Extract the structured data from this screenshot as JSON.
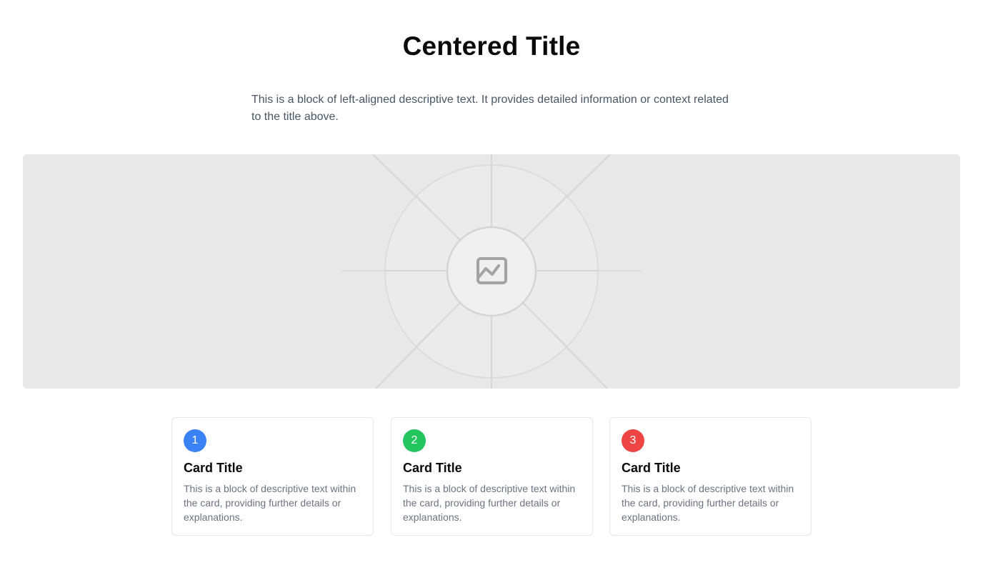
{
  "header": {
    "title": "Centered Title",
    "description": "This is a block of left-aligned descriptive text. It provides detailed information or context related to the title above."
  },
  "hero": {
    "icon": "image-placeholder-icon",
    "background_color": "#e8e8e8"
  },
  "cards": [
    {
      "number": "1",
      "title": "Card Title",
      "text": "This is a block of descriptive text within the card, providing further details or explanations.",
      "badge_color": "#3b82f6"
    },
    {
      "number": "2",
      "title": "Card Title",
      "text": "This is a block of descriptive text within the card, providing further details or explanations.",
      "badge_color": "#22c55e"
    },
    {
      "number": "3",
      "title": "Card Title",
      "text": "This is a block of descriptive text within the card, providing further details or explanations.",
      "badge_color": "#ef4444"
    }
  ]
}
